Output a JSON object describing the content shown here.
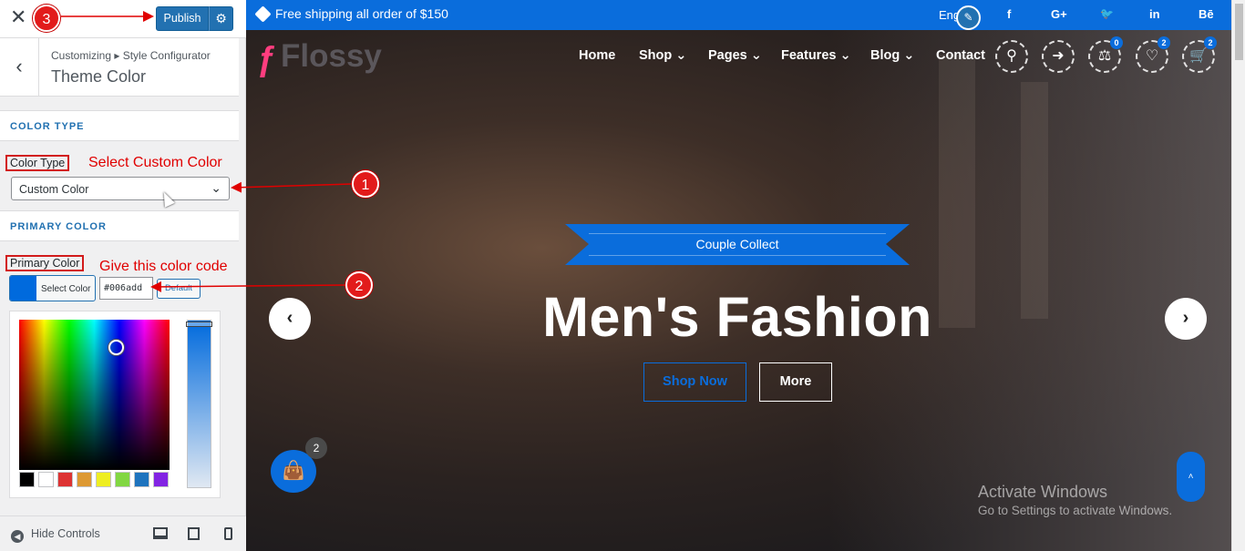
{
  "customizer": {
    "close_label": "✕",
    "publish_label": "Publish",
    "breadcrumb": "Customizing ▸ Style Configurator",
    "section_title": "Theme Color",
    "color_type_heading": "COLOR TYPE",
    "color_type_label": "Color Type",
    "color_type_value": "Custom Color",
    "primary_color_heading": "PRIMARY COLOR",
    "primary_color_label": "Primary Color",
    "select_color_label": "Select Color",
    "hex_value": "#006add",
    "default_label": "Default",
    "selected_color": "#006add",
    "palette": [
      "#000000",
      "#ffffff",
      "#dd3333",
      "#dd9933",
      "#eeee22",
      "#81d742",
      "#1e73be",
      "#8224e3"
    ],
    "hide_controls_label": "Hide Controls"
  },
  "annotations": {
    "step1": "1",
    "step2": "2",
    "step3": "3",
    "select_custom_color": "Select Custom Color",
    "give_color_code": "Give this color code"
  },
  "preview": {
    "topbar_text": "Free shipping all order of $150",
    "language": "Eng",
    "social": [
      "f",
      "G+",
      "🐦",
      "in",
      "Bē"
    ],
    "logo_text": "Flossy",
    "nav": [
      "Home",
      "Shop",
      "Pages",
      "Features",
      "Blog",
      "Contact"
    ],
    "compare_count": "0",
    "wishlist_count": "2",
    "cart_count": "2",
    "ribbon_text": "Couple Collect",
    "hero_title": "Men's Fashion",
    "shop_now": "Shop Now",
    "more": "More",
    "floating_cart_count": "2",
    "activate_line1": "Activate Windows",
    "activate_line2": "Go to Settings to activate Windows."
  }
}
